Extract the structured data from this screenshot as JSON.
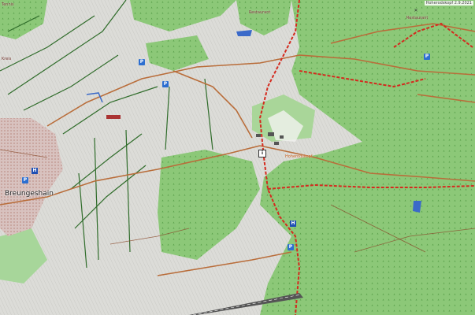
{
  "map": {
    "town_label": "Breungeshain",
    "poi_labels": [
      "Restaurant",
      "Restaurant"
    ],
    "orange_label": "Hoherodskopf",
    "attribution": "Hoherodskopf 2.9.2021",
    "top_left_label": "Tennis",
    "left_label": "Kreis",
    "icons": [
      "parking-icon",
      "info-icon",
      "hotel-icon",
      "restaurant-icon",
      "cable-car-icon"
    ],
    "colors": {
      "forest": "#8cc878",
      "farmland": "#e5e5e1",
      "trail": "#d42a1e",
      "road": "#b96d3a",
      "path": "#3d7a2f",
      "water": "#3b6ac9"
    }
  }
}
